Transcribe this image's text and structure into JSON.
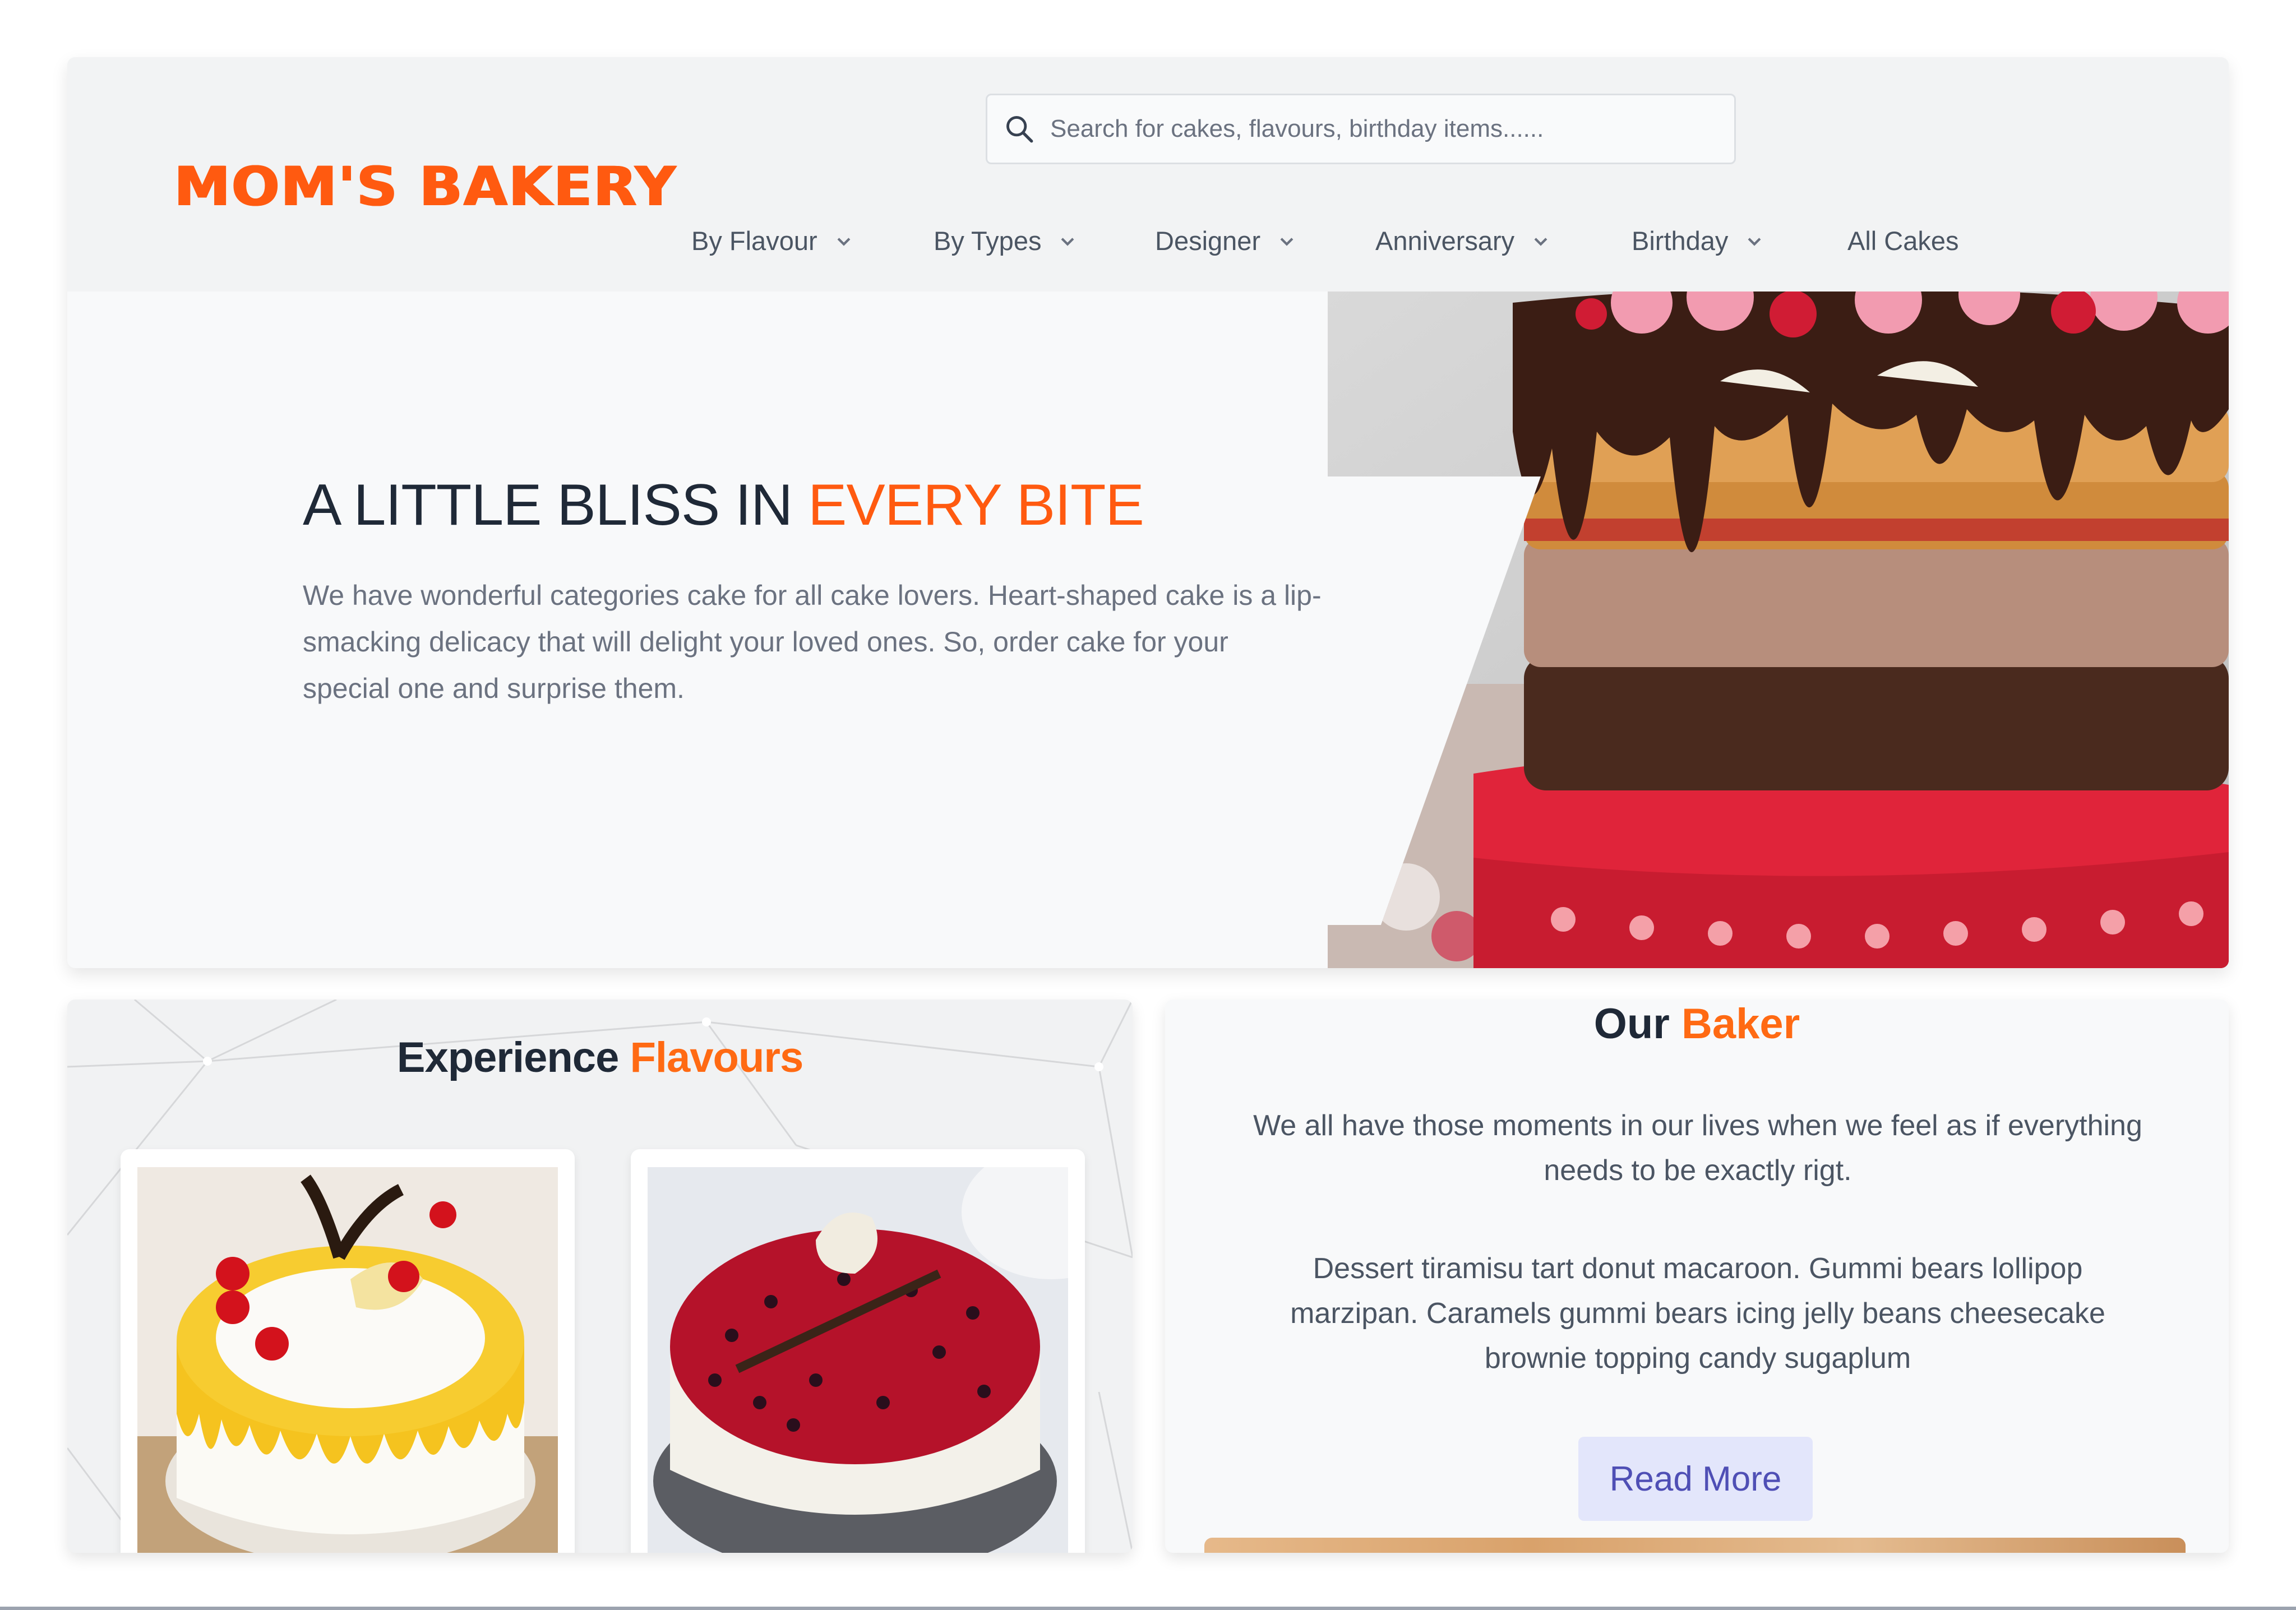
{
  "brand": {
    "name": "MOM'S BAKERY",
    "color": "#ff5a10"
  },
  "search": {
    "placeholder": "Search for cakes, flavours, birthday items......",
    "icon": "search-icon"
  },
  "nav": {
    "items": [
      {
        "label": "By Flavour",
        "has_dropdown": true
      },
      {
        "label": "By Types",
        "has_dropdown": true
      },
      {
        "label": "Designer",
        "has_dropdown": true
      },
      {
        "label": "Anniversary",
        "has_dropdown": true
      },
      {
        "label": "Birthday",
        "has_dropdown": true
      },
      {
        "label": "All Cakes",
        "has_dropdown": false
      }
    ]
  },
  "hero": {
    "title_main": "A LITTLE BLISS IN ",
    "title_accent": "EVERY BITE",
    "description": "We have wonderful categories cake for all cake lovers. Heart-shaped cake is a lip-smacking delicacy that will delight your loved ones. So, order cake for your special one and surprise them."
  },
  "flavours": {
    "title_main": "Experience ",
    "title_accent": "Flavours"
  },
  "baker": {
    "title_main": "Our ",
    "title_accent": "Baker",
    "para1": "We all have those moments in our lives when we feel as if everything needs to be exactly rigt.",
    "para2": "Dessert tiramisu tart donut macaroon. Gummi bears lollipop marzipan. Caramels gummi bears icing jelly beans cheesecake brownie topping candy sugaplum",
    "read_more": "Read More"
  },
  "colors": {
    "accent": "#ff5a10",
    "button_bg": "#e3e6fb",
    "button_text": "#4f4fb5"
  }
}
